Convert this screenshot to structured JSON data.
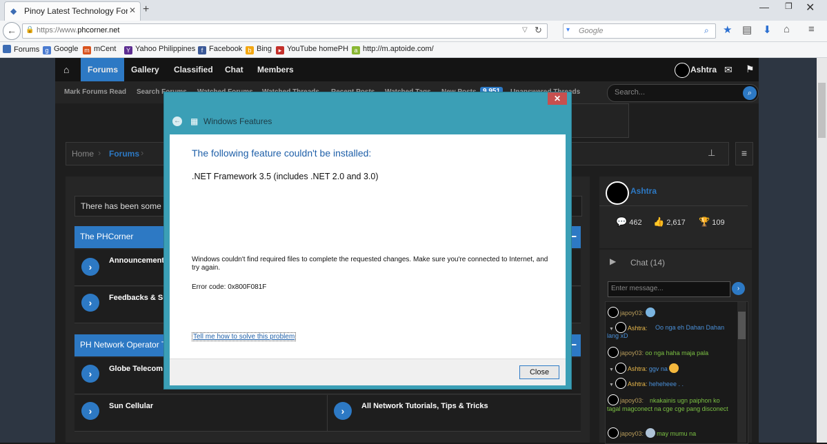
{
  "browser": {
    "tab_title": "Pinoy Latest Technology Foru...",
    "url_scheme": "https://www.",
    "url_host": "phcorner.net",
    "search_placeholder": "Google",
    "bookmarks": [
      "Forums",
      "Google",
      "mCent",
      "Yahoo Philippines",
      "Facebook",
      "Bing",
      "YouTube homePH",
      "http://m.aptoide.com/"
    ]
  },
  "site": {
    "nav": [
      "Forums",
      "Gallery",
      "Classified",
      "Chat",
      "Members"
    ],
    "user": "Ashtra",
    "subnav": [
      "Mark Forums Read",
      "Search Forums",
      "Watched Forums",
      "Watched Threads",
      "Recent Posts",
      "Watched Tags",
      "New Posts"
    ],
    "subnav_badge": "9,951",
    "subnav_last": "Unanswered Threads",
    "search_placeholder": "Search...",
    "breadcrumb": {
      "home": "Home",
      "current": "Forums"
    },
    "notice": "There has been some pr",
    "categories": [
      {
        "title": "The PHCorner",
        "forums": [
          "Announcements",
          "Feedbacks & Su"
        ]
      },
      {
        "title": "PH Network Operator Tr",
        "forums": [
          "Globe Telecom &",
          "Sun Cellular",
          "All Network Tutorials, Tips & Tricks"
        ]
      }
    ]
  },
  "sidebar": {
    "user_name": "Ashtra",
    "stats": {
      "messages": "462",
      "likes": "2,617",
      "trophies": "109"
    },
    "chat_title": "Chat (14)",
    "chat_placeholder": "Enter message...",
    "chat_messages": [
      {
        "user": "japoy03",
        "text": ""
      },
      {
        "user": "Ashtra",
        "text": "Oo nga eh Dahan Dahan lang xD"
      },
      {
        "user": "japoy03",
        "text": "oo nga haha maja pala"
      },
      {
        "user": "Ashtra",
        "text": "ggv na"
      },
      {
        "user": "Ashtra",
        "text": "heheheee . ."
      },
      {
        "user": "japoy03",
        "text": "nkakainis ugn paiphon ko tagal magconect na cge cge pang disconect"
      },
      {
        "user": "japoy03",
        "text": "may mumu na"
      }
    ]
  },
  "dialog": {
    "title": "Windows Features",
    "heading": "The following feature couldn't be installed:",
    "feature": ".NET Framework 3.5 (includes .NET 2.0 and 3.0)",
    "message": "Windows couldn't find required files to complete the requested changes. Make sure you're connected to Internet, and try again.",
    "error_code": "Error code: 0x800F081F",
    "help_link": "Tell me how to solve this problem",
    "close_button": "Close"
  },
  "colors": {
    "accent": "#2d79c4",
    "dialog_frame": "#3b9fb6",
    "close_red": "#c7504f"
  }
}
